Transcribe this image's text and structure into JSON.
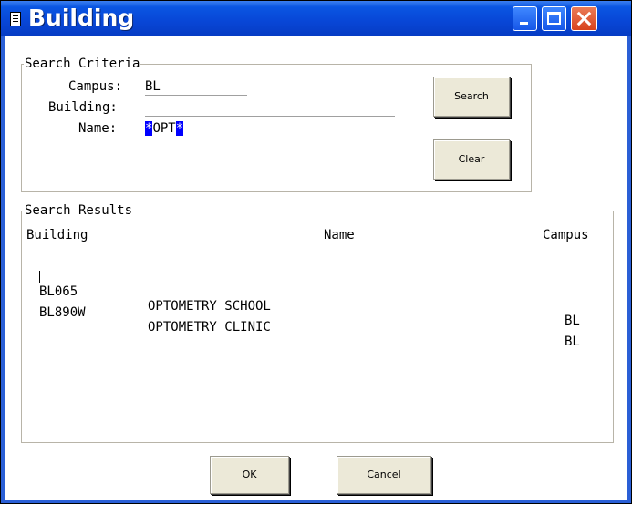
{
  "window": {
    "title": "Building"
  },
  "criteria": {
    "legend": "Search Criteria",
    "campus_label": "Campus:",
    "campus_value": "BL",
    "building_label": "Building:",
    "building_value": "",
    "name_label": "Name:",
    "name_wild_left": "*",
    "name_core": "OPT",
    "name_wild_right": "*",
    "search_button": "Search",
    "clear_button": "Clear"
  },
  "results": {
    "legend": "Search Results",
    "columns": [
      "Building",
      "Name",
      "Campus"
    ],
    "rows": [
      {
        "building": "BL065",
        "name": "OPTOMETRY SCHOOL",
        "campus": "BL"
      },
      {
        "building": "BL890W",
        "name": "OPTOMETRY CLINIC",
        "campus": "BL"
      }
    ]
  },
  "footer": {
    "ok_button": "OK",
    "cancel_button": "Cancel"
  }
}
